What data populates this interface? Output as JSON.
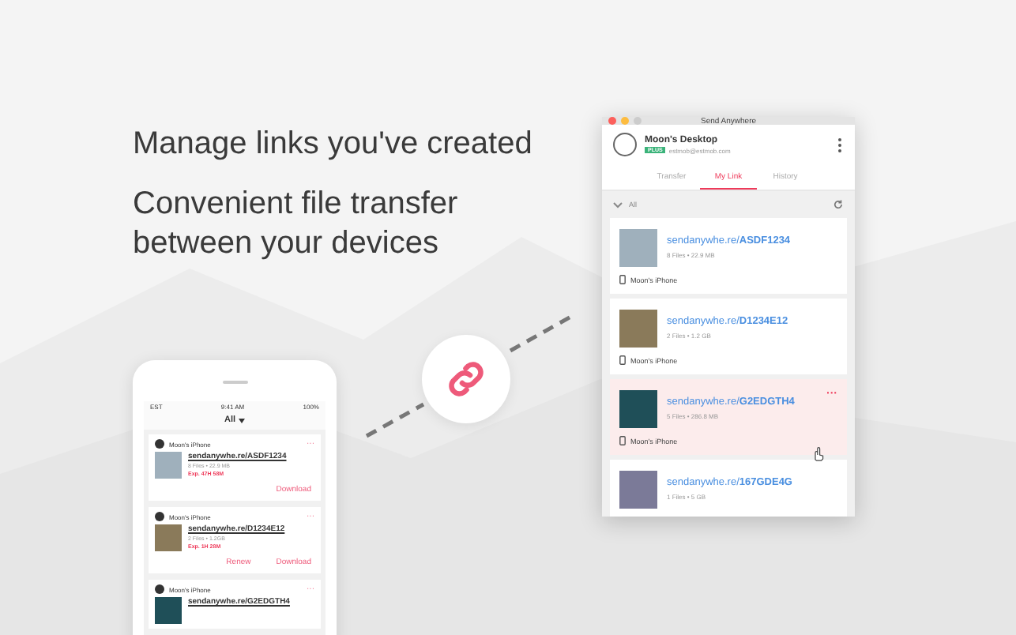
{
  "headline": "Manage links you've created",
  "subheadline": "Convenient file transfer between your devices",
  "phone": {
    "status": {
      "carrier": "EST",
      "time": "9:41 AM",
      "battery": "100%"
    },
    "filter": "All",
    "menu_icon": "···",
    "cards": [
      {
        "device": "Moon's iPhone",
        "link": "sendanywhe.re/ASDF1234",
        "meta": "8 Files • 22.9 MB",
        "expiry": "Exp. 47H 58M",
        "actions": [
          "Download"
        ]
      },
      {
        "device": "Moon's iPhone",
        "link": "sendanywhe.re/D1234E12",
        "meta": "2 Files • 1.2GB",
        "expiry": "Exp. 1H 28M",
        "actions": [
          "Renew",
          "Download"
        ]
      },
      {
        "device": "Moon's iPhone",
        "link": "sendanywhe.re/G2EDGTH4"
      }
    ]
  },
  "window": {
    "title": "Send Anywhere",
    "profile": {
      "name": "Moon's Desktop",
      "badge": "PLUS",
      "email": "estmob@estmob.com"
    },
    "tabs": [
      {
        "label": "Transfer",
        "selected": false
      },
      {
        "label": "My Link",
        "selected": true
      },
      {
        "label": "History",
        "selected": false
      }
    ],
    "filter": "All",
    "links": [
      {
        "link": "sendanywhe.re/**ASDF1234**",
        "meta": "8 Files • 22.9 MB",
        "device": "Moon's iPhone",
        "highlighted": false
      },
      {
        "link": "sendanywhe.re/**D1234E12**",
        "meta": "2 Files • 1.2 GB",
        "device": "Moon's iPhone",
        "highlighted": false
      },
      {
        "link": "sendanywhe.re/**G2EDGTH4**",
        "meta": "5 Files • 286.8 MB",
        "device": "Moon's iPhone",
        "highlighted": true,
        "menu": "···"
      },
      {
        "link": "sendanywhe.re/**167GDE4G**",
        "meta": "1 Files • 5 GB",
        "highlighted": false
      }
    ]
  }
}
